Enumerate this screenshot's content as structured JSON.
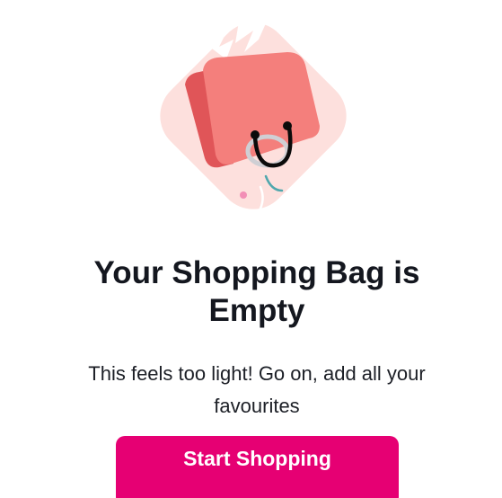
{
  "empty_state": {
    "title": "Your Shopping Bag is Empty",
    "message": "This feels too light! Go on, add all your favourites",
    "cta_label": "Start Shopping"
  },
  "colors": {
    "accent": "#e60073",
    "title": "#14171f",
    "text": "#1c1f26",
    "backdrop": "#fde0dd",
    "bag_front": "#f47f7c",
    "bag_side": "#e05558"
  },
  "icons": {
    "illustration": "empty-shopping-bag-icon"
  }
}
